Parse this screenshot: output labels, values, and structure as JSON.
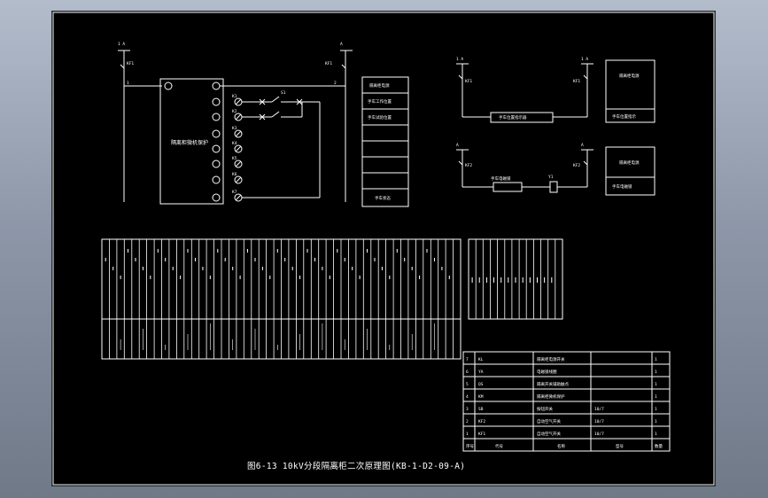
{
  "drawing": {
    "caption": "图6-13 10kV分段隔离柜二次原理图(KB-1-D2-09-A)"
  },
  "circuit_main": {
    "bus_left_label": "1 A",
    "bus_right_label": "A",
    "fuse_left_label": "KF1",
    "fuse_right_label": "KF1",
    "wire_left_label": "1",
    "wire_right_label": "2",
    "device_label": "隔离柜微机保护",
    "terminal_labels": [
      "K1",
      "K2",
      "K3",
      "K4",
      "K5",
      "K6",
      "K7"
    ],
    "switch_label": "S1"
  },
  "legend_box": {
    "rows": [
      "隔离柜电源",
      "手车工作位置",
      "手车试验位置",
      "",
      "",
      "",
      "",
      "手车状态"
    ]
  },
  "circuit_top_right": {
    "left_top_label": "1 A",
    "right_top_label": "1 A",
    "fuse_left_label": "KF1",
    "fuse_right_label": "KF1",
    "component_label": "手车位置指示器",
    "box_rows": [
      "隔离柜电源",
      "手车位置指示"
    ]
  },
  "circuit_mid_right": {
    "left_top_label": "A",
    "right_top_label": "A",
    "fuse_left_label": "KF2",
    "fuse_right_label": "KF2",
    "component_label": "手车电磁锁",
    "relay_label": "Y1",
    "box_rows": [
      "隔离柜电源",
      "手车电磁锁"
    ]
  },
  "bom_table": {
    "rows": [
      {
        "no": "7",
        "symbol": "KL",
        "name": "隔离柜电源开关",
        "spec": "",
        "qty": "1"
      },
      {
        "no": "6",
        "symbol": "YA",
        "name": "电磁锁线圈",
        "spec": "",
        "qty": "1"
      },
      {
        "no": "5",
        "symbol": "QS",
        "name": "隔离开关辅助触点",
        "spec": "",
        "qty": "1"
      },
      {
        "no": "4",
        "symbol": "KM",
        "name": "隔离柜微机保护",
        "spec": "",
        "qty": "1"
      },
      {
        "no": "3",
        "symbol": "SB",
        "name": "按钮开关",
        "spec": "10/7",
        "qty": "1"
      },
      {
        "no": "2",
        "symbol": "KF2",
        "name": "自动空气开关",
        "spec": "10/7",
        "qty": "1"
      },
      {
        "no": "1",
        "symbol": "KF1",
        "name": "自动空气开关",
        "spec": "10/7",
        "qty": "1"
      }
    ],
    "header": {
      "no": "序号",
      "symbol": "代号",
      "name": "名称",
      "spec": "型号",
      "qty": "数量"
    }
  }
}
